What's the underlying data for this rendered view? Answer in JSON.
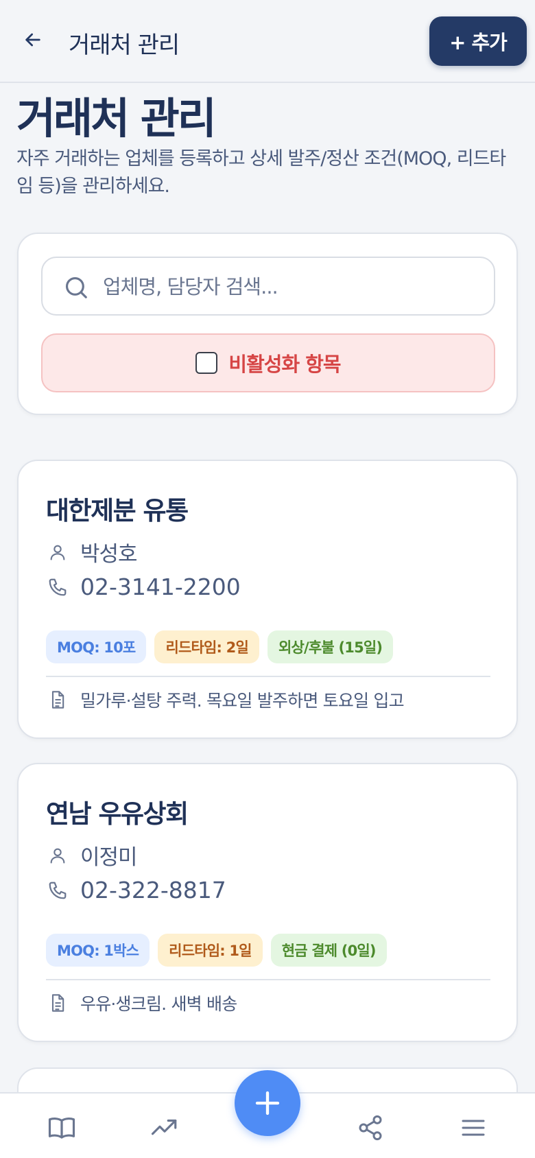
{
  "header": {
    "title": "거래처 관리",
    "add_label": "+ 추가"
  },
  "page": {
    "heading": "거래처 관리",
    "description": "자주 거래하는 업체를 등록하고 상세 발주/정산 조건(MOQ, 리드타임 등)을 관리하세요."
  },
  "filters": {
    "search_placeholder": "업체명, 담당자 검색...",
    "search_value": "",
    "inactive_label": "비활성화 항목",
    "inactive_checked": false
  },
  "vendors": [
    {
      "name": "대한제분 유통",
      "contact": "박성호",
      "phone": "02-3141-2200",
      "moq": "MOQ: 10포",
      "lead_time": "리드타임: 2일",
      "payment": "외상/후불 (15일)",
      "note": "밀가루·설탕 주력. 목요일 발주하면 토요일 입고"
    },
    {
      "name": "연남 우유상회",
      "contact": "이정미",
      "phone": "02-322-8817",
      "moq": "MOQ: 1박스",
      "lead_time": "리드타임: 1일",
      "payment": "현금 결제 (0일)",
      "note": "우유·생크림. 새벽 배송"
    }
  ],
  "nav": {
    "items": [
      "book-icon",
      "trending-up-icon",
      "plus-icon",
      "share-icon",
      "menu-icon"
    ]
  },
  "colors": {
    "primary": "#243a66",
    "accent": "#4f8cf5",
    "danger": "#d64545"
  }
}
